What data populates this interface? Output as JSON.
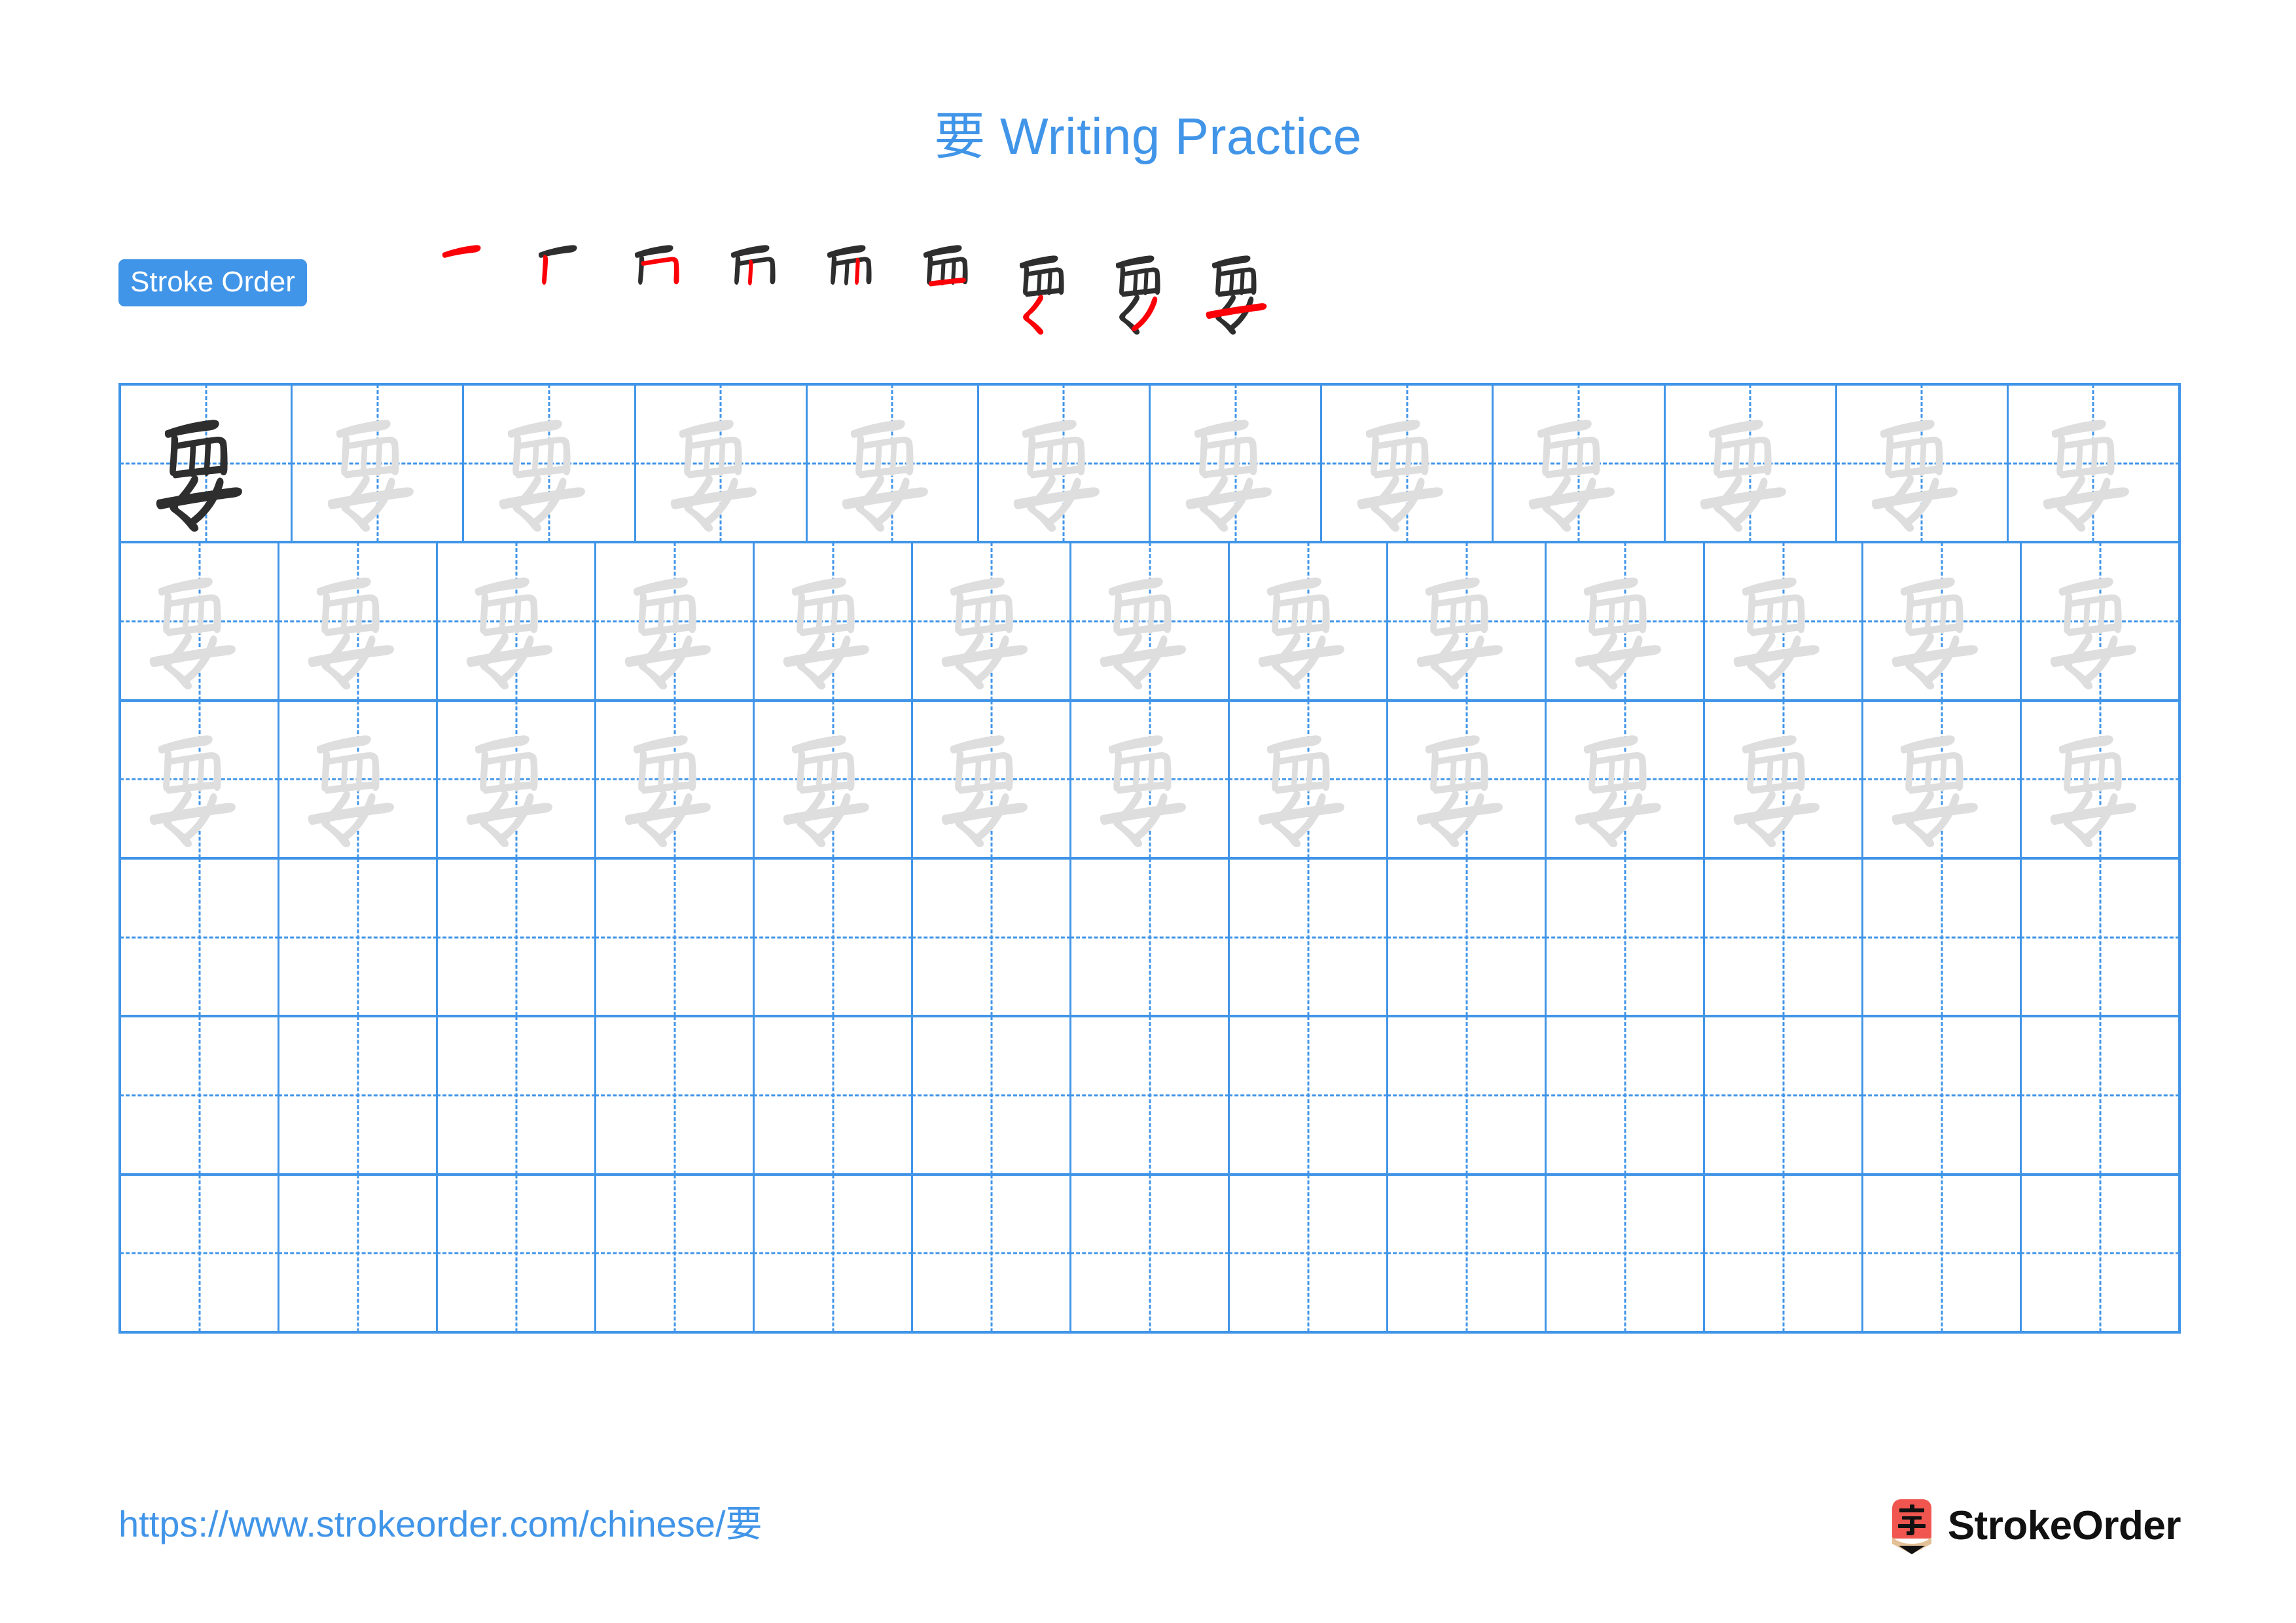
{
  "page": {
    "title_char": "要",
    "title_suffix": " Writing Practice",
    "accent_color": "#4195e8",
    "stroke_new_color": "#fb0007",
    "stroke_done_color": "#2e2e2e",
    "trace_color": "#dedede"
  },
  "stroke_order": {
    "badge_label": "Stroke Order",
    "character": "要",
    "total_strokes": 9,
    "steps": [
      {
        "index": 1,
        "partial": "一",
        "new_stroke": "héng (horizontal top)"
      },
      {
        "index": 2,
        "partial": "厂",
        "new_stroke": "shù (left vertical)"
      },
      {
        "index": 3,
        "partial": "冖",
        "new_stroke": "héngzhé (turn right)"
      },
      {
        "index": 4,
        "partial": "帀",
        "new_stroke": "shù (inner vertical)"
      },
      {
        "index": 5,
        "partial": "襾",
        "new_stroke": "shù (second inner vertical)"
      },
      {
        "index": 6,
        "partial": "西",
        "new_stroke": "héng (sealing horizontal)"
      },
      {
        "index": 7,
        "partial": "覀𡿨",
        "new_stroke": "piě-diǎn (女 first stroke)"
      },
      {
        "index": 8,
        "partial": "覀女",
        "new_stroke": "piě (女 second stroke)"
      },
      {
        "index": 9,
        "partial": "要",
        "new_stroke": "héng (女 final horizontal)"
      }
    ]
  },
  "practice_grid": {
    "columns": 13,
    "rows": 6,
    "character": "要",
    "row_fill": [
      "model-then-trace",
      "trace",
      "trace",
      "empty",
      "empty",
      "empty"
    ]
  },
  "footer": {
    "url": "https://www.strokeorder.com/chinese/要",
    "brand_name": "StrokeOrder",
    "logo_char": "字"
  }
}
